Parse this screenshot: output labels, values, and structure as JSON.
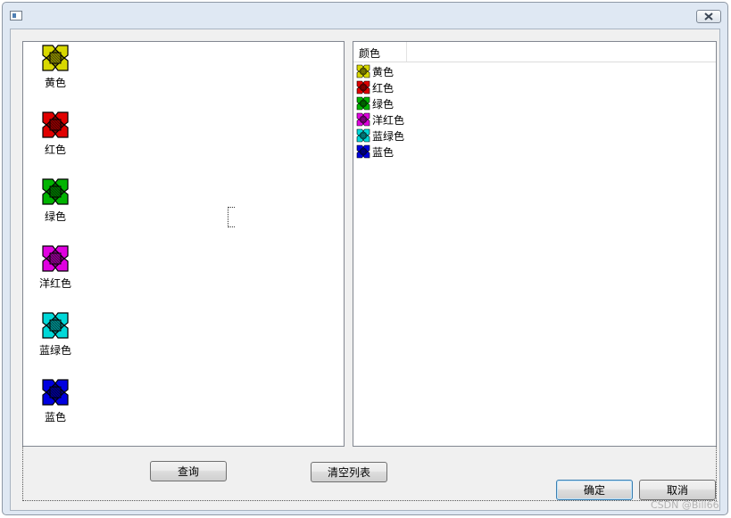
{
  "dialog": {
    "title": "",
    "icon": "app-window-icon",
    "close_icon": "close-x-icon"
  },
  "icon_view": {
    "items": [
      {
        "label": "黄色",
        "color": "#d8d800",
        "icon": "yellow-cross-icon"
      },
      {
        "label": "红色",
        "color": "#e00000",
        "icon": "red-cross-icon"
      },
      {
        "label": "绿色",
        "color": "#00b400",
        "icon": "green-cross-icon"
      },
      {
        "label": "洋红色",
        "color": "#e000e0",
        "icon": "magenta-cross-icon"
      },
      {
        "label": "蓝绿色",
        "color": "#00d8d8",
        "icon": "cyan-cross-icon"
      },
      {
        "label": "蓝色",
        "color": "#0000e0",
        "icon": "blue-cross-icon"
      }
    ]
  },
  "list_view": {
    "column_header": "颜色",
    "rows": [
      {
        "label": "黄色",
        "color": "#d8d800"
      },
      {
        "label": "红色",
        "color": "#e00000"
      },
      {
        "label": "绿色",
        "color": "#00b400"
      },
      {
        "label": "洋红色",
        "color": "#e000e0"
      },
      {
        "label": "蓝绿色",
        "color": "#00d8d8"
      },
      {
        "label": "蓝色",
        "color": "#0000e0"
      }
    ]
  },
  "buttons": {
    "query": "查询",
    "clear_list": "清空列表",
    "ok": "确定",
    "cancel": "取消"
  },
  "watermark": "CSDN @Bill66"
}
